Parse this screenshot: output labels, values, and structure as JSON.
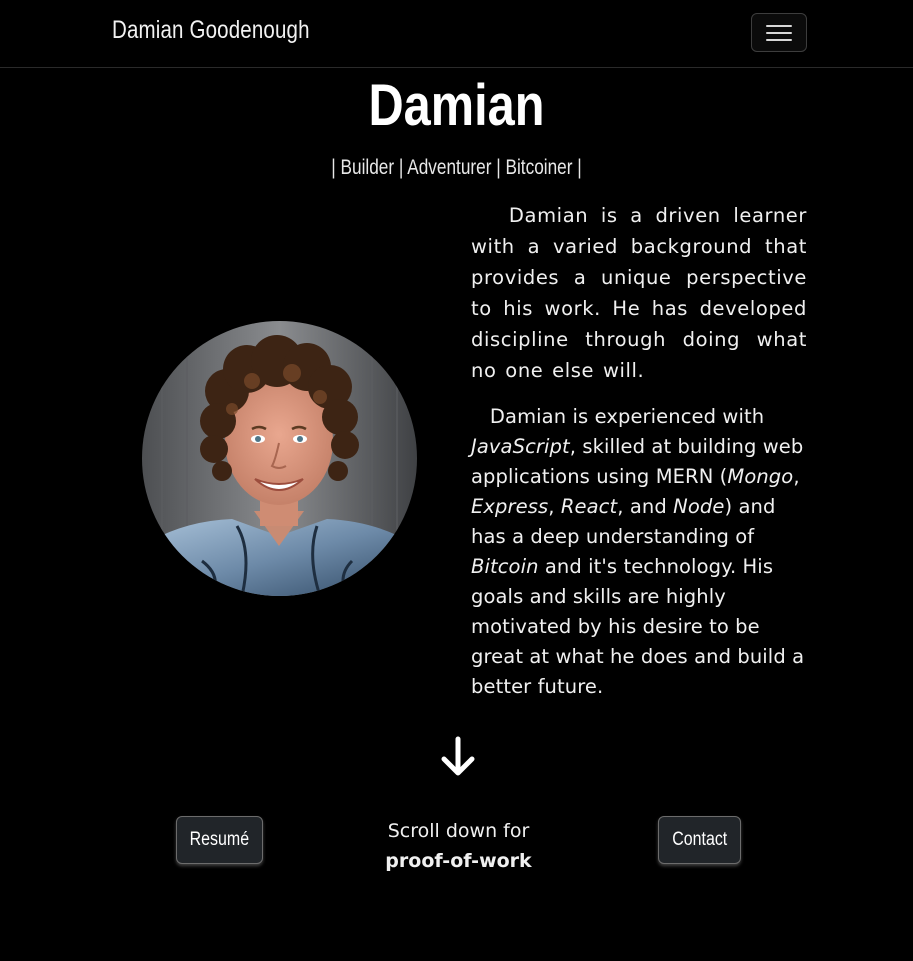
{
  "navbar": {
    "brand": "Damian Goodenough",
    "menu_icon": "hamburger-menu-icon"
  },
  "hero": {
    "name": "Damian",
    "tagline": "| Builder | Adventurer | Bitcoiner |"
  },
  "bio": {
    "paragraph_1": "Damian is a driven learner with a varied background that provides a unique perspective to his work. He has developed discipline through doing what no one else will.",
    "paragraph_2": {
      "t1": "Damian is experienced with ",
      "lang": "JavaScript",
      "t2": ", skilled at building web applications using MERN (",
      "mongo": "Mongo",
      "sep1": ", ",
      "express": "Express",
      "sep2": ", ",
      "react": "React",
      "t3": ", and ",
      "node": "Node",
      "t4": ") and has a deep understanding of ",
      "bitcoin": "Bitcoin",
      "t5": " and it's technology. His goals and skills are highly motivated by his desire to be great at what he does and build a better future."
    }
  },
  "portrait": {
    "icon": "profile-photo"
  },
  "scroll": {
    "arrow_icon": "arrow-down-icon",
    "line_1": "Scroll down for",
    "line_2": "proof-of-work"
  },
  "buttons": {
    "resume": "Resumé",
    "contact": "Contact"
  },
  "colors": {
    "background": "#000000",
    "button_bg": "#212529",
    "text": "#ffffff"
  }
}
